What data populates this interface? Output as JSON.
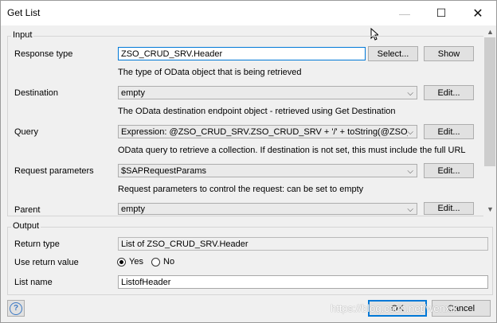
{
  "window": {
    "title": "Get List",
    "minimize_glyph": "—",
    "maximize_glyph": "☐",
    "close_glyph": "✕"
  },
  "input": {
    "legend": "Input",
    "response_type": {
      "label": "Response type",
      "value": "ZSO_CRUD_SRV.Header",
      "select_label": "Select...",
      "show_label": "Show",
      "hint": "The type of OData object that is being retrieved"
    },
    "destination": {
      "label": "Destination",
      "value": "empty",
      "edit_label": "Edit...",
      "hint": "The OData destination endpoint object - retrieved using Get Destination"
    },
    "query": {
      "label": "Query",
      "value": "Expression: @ZSO_CRUD_SRV.ZSO_CRUD_SRV + '/' + toString(@ZSO_C",
      "edit_label": "Edit...",
      "hint": "OData query to retrieve a collection. If destination is not set, this must include the full URL"
    },
    "request_parameters": {
      "label": "Request parameters",
      "value": "$SAPRequestParams",
      "edit_label": "Edit...",
      "hint": "Request parameters to control the request: can be set to empty"
    },
    "parent": {
      "label": "Parent",
      "value": "empty",
      "edit_label": "Edit..."
    }
  },
  "output": {
    "legend": "Output",
    "return_type": {
      "label": "Return type",
      "value": "List of ZSO_CRUD_SRV.Header"
    },
    "use_return_value": {
      "label": "Use return value",
      "options": [
        "Yes",
        "No"
      ],
      "selected": "Yes"
    },
    "list_name": {
      "label": "List name",
      "value": "ListofHeader"
    }
  },
  "footer": {
    "help_glyph": "?",
    "ok_label": "OK",
    "cancel_label": "Cancel",
    "watermark": "https://blog.csdn.net/wenxix"
  },
  "colors": {
    "accent": "#0078d7",
    "dialog_background": "#f0f0f0",
    "help_icon": "#3b78c4"
  }
}
